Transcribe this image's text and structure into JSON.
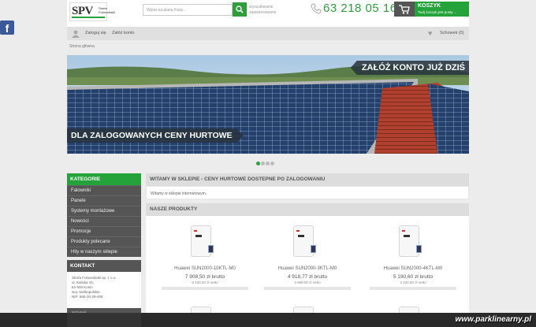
{
  "logo": {
    "big": "SPV",
    "small": "Strefa Fotowoltaiki"
  },
  "search": {
    "placeholder": "Wpisz szukaną frazę...",
    "advanced": "wyszukiwanie zaawansowane"
  },
  "phone": "63 218 05 16",
  "cart": {
    "title": "KOSZYK",
    "subtitle": "Twój koszyk jest pusty ..."
  },
  "topbar": {
    "login": "Zaloguj się",
    "register": "Załóż konto",
    "wishlist": "Schowek (0)"
  },
  "breadcrumb": "Strona główna",
  "banner": {
    "top_text": "ZAŁÓŻ KONTO JUŻ DZIŚ",
    "bottom_text": "DLA ZALOGOWANYCH CENY HURTOWE"
  },
  "categories": {
    "title": "KATEGORIE",
    "items": [
      "Falowniki",
      "Panele",
      "Systemy montażowe",
      "Nowości",
      "Promocje",
      "Produkty polecane",
      "Hity w naszym sklepie"
    ]
  },
  "contact": {
    "title": "KONTAKT",
    "lines": [
      "Strefa Fotowoltaiki sp. z o.o.",
      "ul. Kaliska 15,",
      "62-500 Konin",
      "woj. wielkopolskie",
      "NIP: 665-30-29-408"
    ],
    "mail": "E-mail"
  },
  "welcome": {
    "title": "WITAMY W SKLEPIE - CENY HURTOWE DOSTEPNE PO ZALOGOWANIU",
    "body": "Witamy w sklepie internetowym."
  },
  "products": {
    "title": "NASZE PRODUKTY",
    "items": [
      {
        "name": "Huawei SUN2000-10KTL-M0",
        "gross": "7 908,50 zł brutto",
        "net": "6 430,00 zł netto"
      },
      {
        "name": "Huawei SUN2000-3KTL-M0",
        "gross": "4 918,77 zł brutto",
        "net": "3 999,00 zł netto"
      },
      {
        "name": "Huawei SUN2000-4KTL-M0",
        "gross": "5 190,60 zł brutto",
        "net": "4 220,00 zł netto"
      }
    ]
  },
  "watermark": "www.parklinearny.pl",
  "colors": {
    "accent": "#23a33a",
    "dark": "#555555"
  }
}
